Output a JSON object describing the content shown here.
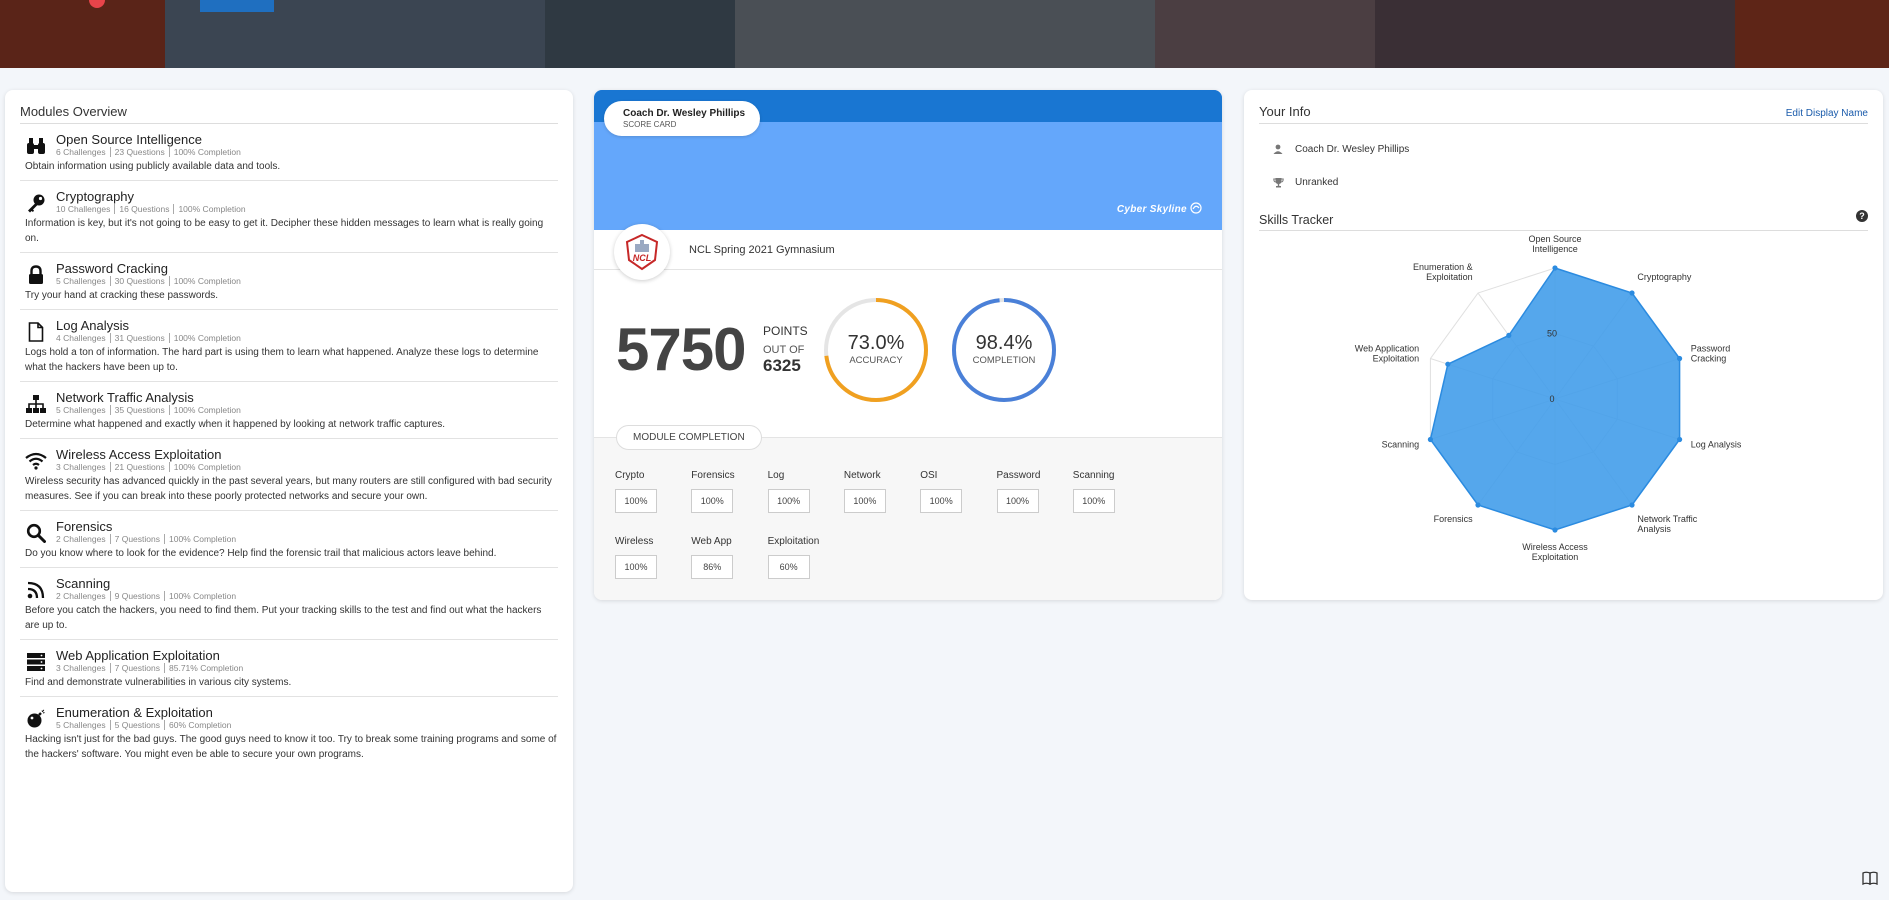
{
  "modules_overview": {
    "title": "Modules Overview",
    "items": [
      {
        "name": "Open Source Intelligence",
        "challenges": "6 Challenges",
        "questions": "23 Questions",
        "completion": "100% Completion",
        "description": "Obtain information using publicly available data and tools.",
        "icon": "binoculars-icon"
      },
      {
        "name": "Cryptography",
        "challenges": "10 Challenges",
        "questions": "16 Questions",
        "completion": "100% Completion",
        "description": "Information is key, but it's not going to be easy to get it. Decipher these hidden messages to learn what is really going on.",
        "icon": "key-icon"
      },
      {
        "name": "Password Cracking",
        "challenges": "5 Challenges",
        "questions": "30 Questions",
        "completion": "100% Completion",
        "description": "Try your hand at cracking these passwords.",
        "icon": "lock-icon"
      },
      {
        "name": "Log Analysis",
        "challenges": "4 Challenges",
        "questions": "31 Questions",
        "completion": "100% Completion",
        "description": "Logs hold a ton of information. The hard part is using them to learn what happened. Analyze these logs to determine what the hackers have been up to.",
        "icon": "file-icon"
      },
      {
        "name": "Network Traffic Analysis",
        "challenges": "5 Challenges",
        "questions": "35 Questions",
        "completion": "100% Completion",
        "description": "Determine what happened and exactly when it happened by looking at network traffic captures.",
        "icon": "network-icon"
      },
      {
        "name": "Wireless Access Exploitation",
        "challenges": "3 Challenges",
        "questions": "21 Questions",
        "completion": "100% Completion",
        "description": "Wireless security has advanced quickly in the past several years, but many routers are still configured with bad security measures. See if you can break into these poorly protected networks and secure your own.",
        "icon": "wifi-icon"
      },
      {
        "name": "Forensics",
        "challenges": "2 Challenges",
        "questions": "7 Questions",
        "completion": "100% Completion",
        "description": "Do you know where to look for the evidence? Help find the forensic trail that malicious actors leave behind.",
        "icon": "search-icon"
      },
      {
        "name": "Scanning",
        "challenges": "2 Challenges",
        "questions": "9 Questions",
        "completion": "100% Completion",
        "description": "Before you catch the hackers, you need to find them. Put your tracking skills to the test and find out what the hackers are up to.",
        "icon": "rss-icon"
      },
      {
        "name": "Web Application Exploitation",
        "challenges": "3 Challenges",
        "questions": "7 Questions",
        "completion": "85.71% Completion",
        "description": "Find and demonstrate vulnerabilities in various city systems.",
        "icon": "server-icon"
      },
      {
        "name": "Enumeration & Exploitation",
        "challenges": "5 Challenges",
        "questions": "5 Questions",
        "completion": "60% Completion",
        "description": "Hacking isn't just for the bad guys. The good guys need to know it too. Try to break some training programs and some of the hackers' software. You might even be able to secure your own programs.",
        "icon": "bomb-icon"
      }
    ]
  },
  "scorecard": {
    "name": "Coach Dr. Wesley Phillips",
    "subtitle": "SCORE CARD",
    "brand": "Cyber Skyline",
    "event": "NCL Spring 2021 Gymnasium",
    "logo_text": "NCL",
    "points": "5750",
    "points_label": "POINTS",
    "out_of_label": "OUT OF",
    "out_of": "6325",
    "accuracy": {
      "value": "73.0%",
      "label": "ACCURACY",
      "fraction": 0.73,
      "color": "#f0a020"
    },
    "completion": {
      "value": "98.4%",
      "label": "COMPLETION",
      "fraction": 0.984,
      "color": "#4a80d8"
    },
    "module_completion_label": "MODULE COMPLETION",
    "modules": [
      {
        "name": "Crypto",
        "value": "100%"
      },
      {
        "name": "Forensics",
        "value": "100%"
      },
      {
        "name": "Log",
        "value": "100%"
      },
      {
        "name": "Network",
        "value": "100%"
      },
      {
        "name": "OSI",
        "value": "100%"
      },
      {
        "name": "Password",
        "value": "100%"
      },
      {
        "name": "Scanning",
        "value": "100%"
      },
      {
        "name": "Wireless",
        "value": "100%"
      },
      {
        "name": "Web App",
        "value": "86%"
      },
      {
        "name": "Exploitation",
        "value": "60%"
      }
    ]
  },
  "your_info": {
    "title": "Your Info",
    "edit_label": "Edit Display Name",
    "user_name": "Coach Dr. Wesley Phillips",
    "rank": "Unranked"
  },
  "skills_tracker": {
    "title": "Skills Tracker",
    "tick_labels": [
      "50",
      "0"
    ],
    "axes": [
      {
        "label": [
          "Open Source",
          "Intelligence"
        ],
        "value": 100
      },
      {
        "label": [
          "Cryptography"
        ],
        "value": 100
      },
      {
        "label": [
          "Password",
          "Cracking"
        ],
        "value": 100
      },
      {
        "label": [
          "Log Analysis"
        ],
        "value": 100
      },
      {
        "label": [
          "Network Traffic",
          "Analysis"
        ],
        "value": 100
      },
      {
        "label": [
          "Wireless Access",
          "Exploitation"
        ],
        "value": 100
      },
      {
        "label": [
          "Forensics"
        ],
        "value": 100
      },
      {
        "label": [
          "Scanning"
        ],
        "value": 100
      },
      {
        "label": [
          "Web Application",
          "Exploitation"
        ],
        "value": 86
      },
      {
        "label": [
          "Enumeration &",
          "Exploitation"
        ],
        "value": 60
      }
    ],
    "fill_color": "#3d9be9"
  }
}
